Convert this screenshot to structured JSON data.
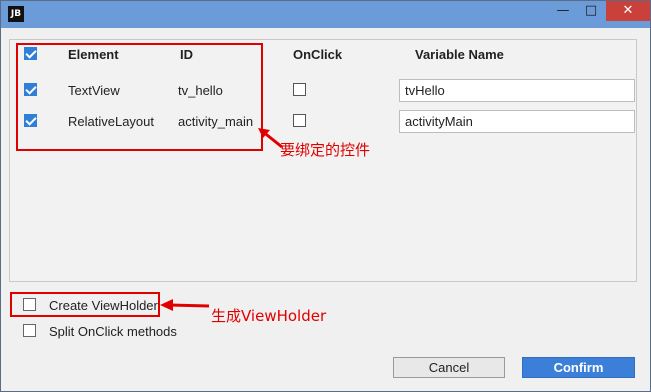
{
  "window": {
    "app_icon_text": "JB",
    "minimize_glyph": "—",
    "maximize_glyph": "□",
    "close_glyph": "✕"
  },
  "table": {
    "headers": {
      "element": "Element",
      "id": "ID",
      "onclick": "OnClick",
      "variable_name": "Variable Name"
    },
    "select_all_checked": true,
    "rows": [
      {
        "checked": true,
        "element": "TextView",
        "id": "tv_hello",
        "onclick": false,
        "variable_name": "tvHello"
      },
      {
        "checked": true,
        "element": "RelativeLayout",
        "id": "activity_main",
        "onclick": false,
        "variable_name": "activityMain"
      }
    ]
  },
  "annotations": {
    "bind_controls": "要绑定的控件",
    "generate_viewholder": "生成ViewHolder"
  },
  "options": {
    "create_viewholder": {
      "label": "Create ViewHolder",
      "checked": false
    },
    "split_onclick": {
      "label": "Split OnClick methods",
      "checked": false
    }
  },
  "buttons": {
    "cancel": "Cancel",
    "confirm": "Confirm"
  },
  "colors": {
    "titlebar": "#6b9bd8",
    "accent": "#3c7fd8",
    "annotation": "#e00000",
    "close_button": "#c9413a"
  }
}
